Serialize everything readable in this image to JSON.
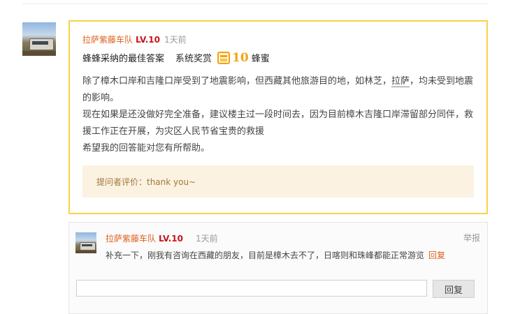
{
  "answer": {
    "user": {
      "name": "拉萨紫藤车队",
      "level": "LV.10",
      "time": "1天前"
    },
    "award": {
      "best_label": "蜂蜂采纳的最佳答案",
      "system_label": "系统奖赏",
      "honey_icon": "honey-jar-icon",
      "honey_amount": "10",
      "honey_unit": "蜂蜜"
    },
    "body": {
      "p1_before": "除了樟木口岸和吉隆口岸受到了地震影响，但西藏其他旅游目的地，如林芝，",
      "p1_keyword": "拉萨",
      "p1_after": "，均未受到地震的影响。",
      "p2": "现在如果是还没做好完全准备，建议楼主过一段时间去，因为目前樟木吉隆口岸滞留部分同伴，救援工作正在开展，为灾区人民节省宝贵的救援",
      "p3": "希望我的回答能对您有所帮助。"
    },
    "feedback": "提问者评价：thank you~"
  },
  "comment": {
    "user": {
      "name": "拉萨紫藤车队",
      "level": "LV.10",
      "time": "1天前"
    },
    "report_label": "举报",
    "text": "补充一下，刚我有咨询在西藏的朋友，目前是樟木去不了，日喀则和珠峰都能正常游览",
    "reply_link": "回复",
    "reply_input_placeholder": "",
    "reply_button": "回复"
  },
  "colors": {
    "accent": "#f7d448",
    "username": "#e0601d",
    "level": "#c8141b",
    "honey": "#f3a316"
  }
}
